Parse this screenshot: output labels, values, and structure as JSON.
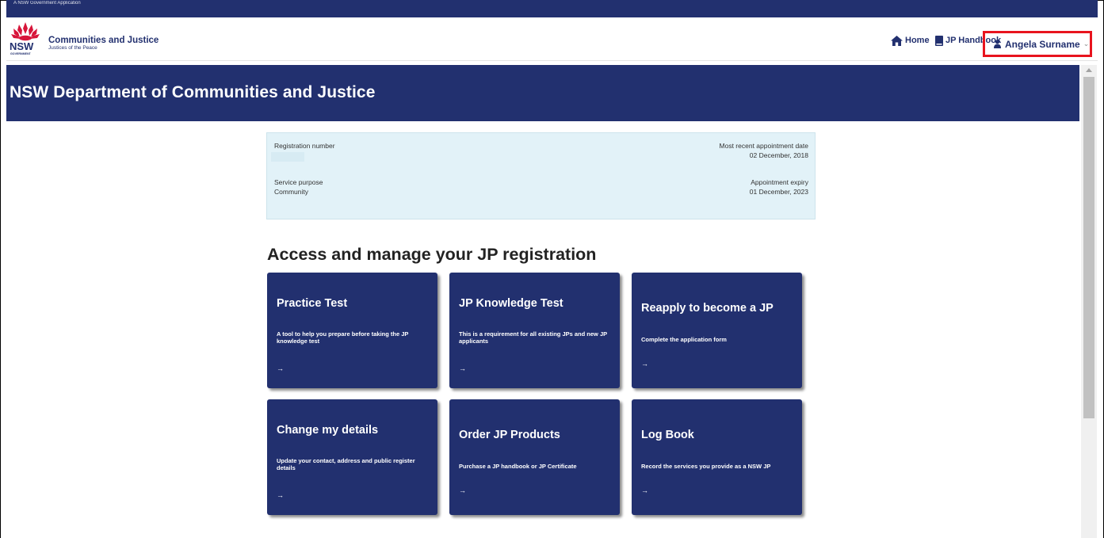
{
  "gov_strip": {
    "text": "A NSW Government Application"
  },
  "header": {
    "logo_text": "NSW",
    "logo_subtext": "GOVERNMENT",
    "brand_title": "Communities and Justice",
    "brand_subtitle": "Justices of the Peace",
    "nav": {
      "home": "Home",
      "handbook": "JP Handbook"
    },
    "user": {
      "name": "Angela Surname",
      "chevron": "⌄"
    }
  },
  "banner": {
    "title": "NSW Department of Communities and Justice"
  },
  "registration": {
    "registration_number_label": "Registration number",
    "registration_number_value": "",
    "recent_appointment_label": "Most recent appointment date",
    "recent_appointment_value": "02 December, 2018",
    "service_purpose_label": "Service purpose",
    "service_purpose_value": "Community",
    "appointment_expiry_label": "Appointment expiry",
    "appointment_expiry_value": "01 December, 2023"
  },
  "section_title": "Access and manage your JP registration",
  "cards": [
    {
      "title": "Practice Test",
      "desc": "A tool to help you prepare before taking the JP knowledge test",
      "arrow": "→"
    },
    {
      "title": "JP Knowledge Test",
      "desc": "This is a requirement for all existing JPs and new JP applicants",
      "arrow": "→"
    },
    {
      "title": "Reapply to become a JP",
      "desc": "Complete the application form",
      "arrow": "→"
    },
    {
      "title": "Change my details",
      "desc": "Update your contact, address and public register details",
      "arrow": "→"
    },
    {
      "title": "Order JP Products",
      "desc": "Purchase a JP handbook or JP Certificate",
      "arrow": "→"
    },
    {
      "title": "Log Book",
      "desc": "Record the services you provide as a NSW JP",
      "arrow": "→"
    }
  ],
  "colors": {
    "brand_navy": "#22306f",
    "highlight_red": "#e8141e",
    "info_bg": "#e2f2f8",
    "waratah_red": "#d7153a"
  }
}
